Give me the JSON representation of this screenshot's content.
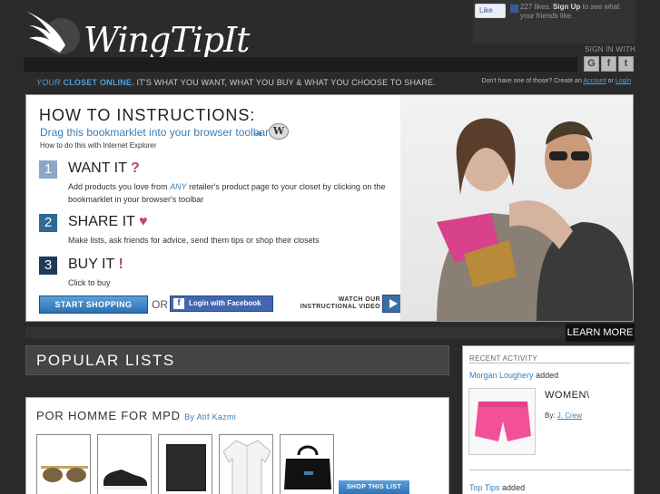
{
  "header": {
    "logo_text": "WingTipIt",
    "facebook": {
      "like_label": "Like",
      "likes_text": "227 likes.",
      "signup_label": "Sign Up",
      "signup_suffix": "to see what your friends like."
    },
    "signin_label": "SIGN IN WITH",
    "signin_icons": [
      "google-icon",
      "facebook-icon",
      "twitter-icon"
    ],
    "tagline": {
      "your": "YOUR",
      "closet": "CLOSET ONLINE.",
      "rest": "IT'S WHAT YOU WANT, WHAT YOU BUY & WHAT YOU CHOOSE TO SHARE."
    },
    "account_prompt": "Don't have one of those? Create an",
    "account_link": "Account",
    "or_word": "or",
    "login_link": "Login"
  },
  "hero": {
    "title": "HOW TO INSTRUCTIONS:",
    "drag_text": "Drag this bookmarklet into your browser toolbar",
    "ie_text": "How to do this with Internet Explorer",
    "steps": [
      {
        "num": "1",
        "title": "WANT IT",
        "mark": "?",
        "desc_pre": "Add products you love from",
        "desc_em": "ANY",
        "desc_post": "retailer's product page to your closet by clicking on the bookmarklet in your browser's toolbar"
      },
      {
        "num": "2",
        "title": "SHARE IT",
        "mark": "♥",
        "desc": "Make lists, ask friends for advice, send them tips or shop their closets"
      },
      {
        "num": "3",
        "title": "BUY IT",
        "mark": "!",
        "desc": "Click to buy"
      }
    ],
    "shop_button": "START SHOPPING",
    "or_text": "OR",
    "fb_login": "Login with Facebook",
    "watch_video": "WATCH OUR INSTRUCTIONAL VIDEO"
  },
  "learn_more": "LEARN MORE",
  "popular": {
    "heading": "POPULAR LISTS",
    "list_title": "POR HOMME FOR MPD",
    "list_by": "By Atif Kazmi",
    "items": [
      "aviator-sunglasses",
      "black-sneaker",
      "black-wallet",
      "white-shirt",
      "black-duffle-bag"
    ],
    "shop_list_button": "SHOP THIS LIST"
  },
  "recent": {
    "heading": "RECENT ACTIVITY",
    "user1": "Morgan Loughery",
    "action1": "added",
    "item_title": "WOMEN\\",
    "by_label": "By:",
    "brand": "J. Crew",
    "user2": "Top Tips",
    "action2": "added"
  },
  "colors": {
    "accent_blue": "#3b7fb8",
    "step1": "#8aa7c6",
    "step2": "#2d6a96",
    "step3": "#1f3b57",
    "accent_pink": "#c0456a"
  }
}
